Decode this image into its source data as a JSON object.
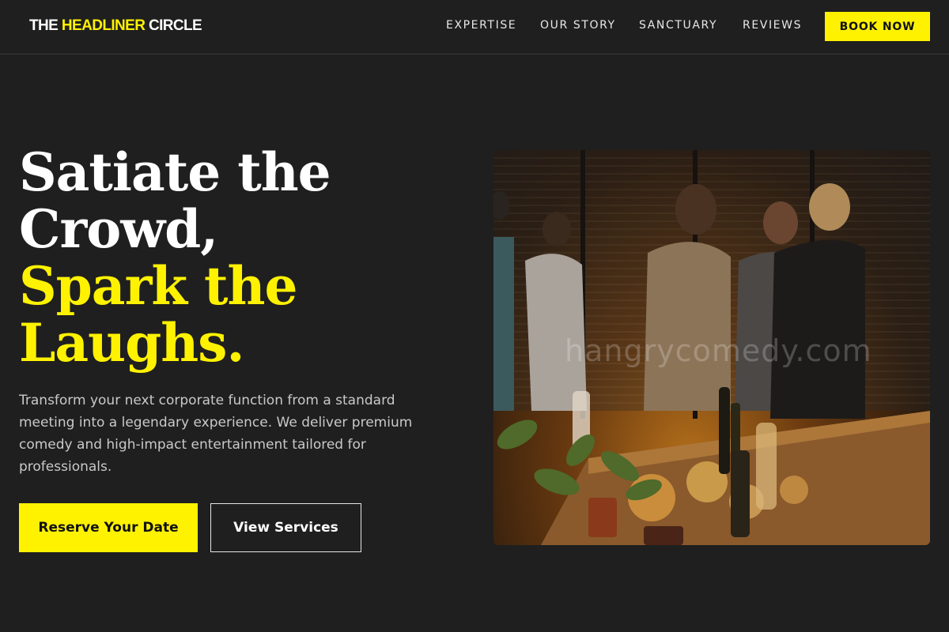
{
  "brand": {
    "logo_part1": "THE ",
    "logo_part2": "HEADLINER",
    "logo_part3": " CIRCLE",
    "accent_color": "#fff200",
    "background_color": "#1f1f1f"
  },
  "nav": {
    "items": [
      {
        "label": "EXPERTISE"
      },
      {
        "label": "OUR STORY"
      },
      {
        "label": "SANCTUARY"
      },
      {
        "label": "REVIEWS"
      }
    ],
    "cta_label": "BOOK NOW"
  },
  "hero": {
    "headline_line1": "Satiate the",
    "headline_line2": "Crowd,",
    "headline_line3": "Spark the",
    "headline_line4": "Laughs.",
    "lead": "Transform your next corporate function from a standard meeting into a legendary experience. We deliver premium comedy and high-impact entertainment tailored for professionals.",
    "primary_button": "Reserve Your Date",
    "secondary_button": "View Services",
    "image_watermark": "hangrycomedy.com"
  }
}
